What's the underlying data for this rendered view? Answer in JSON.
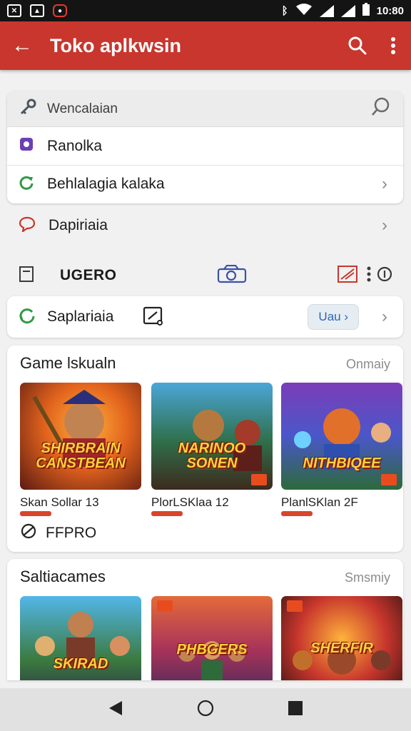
{
  "status_bar": {
    "time": "10:80"
  },
  "app_bar": {
    "title": "Toko aplkwsin"
  },
  "menu": {
    "search_placeholder": "Wencalaian",
    "items": [
      {
        "label": "Ranolka"
      },
      {
        "label": "Behlalagia kalaka"
      }
    ]
  },
  "dapiriaia": {
    "label": "Dapiriaia"
  },
  "toolbar": {
    "label": "UGERO"
  },
  "saplariaia": {
    "label": "Saplariaia",
    "pill": "Uau ›"
  },
  "section1": {
    "title": "Game lskualn",
    "more": "Onmaiy",
    "games": [
      {
        "name": "Skan Sollar 13",
        "art": "SHIRBRAIN CANSTBEAN"
      },
      {
        "name": "PlorLSKlaa 12",
        "art": "NARINOO SONEN"
      },
      {
        "name": "PlanlSKlan 2F",
        "art": "NITHBIQEE"
      }
    ],
    "footer_label": "FFPRO"
  },
  "section2": {
    "title": "Saltiacames",
    "more": "Smsmiy",
    "games": [
      {
        "art": "SKIRAD"
      },
      {
        "art": "PHBGERS"
      },
      {
        "art": "SHERFIR"
      }
    ]
  },
  "colors": {
    "accent": "#c8362d",
    "link": "#2e63b8"
  },
  "icons": [
    "back-arrow-icon",
    "search-icon",
    "more-vert-icon",
    "key-icon",
    "puzzle-icon",
    "refresh-icon",
    "chat-bubble-icon",
    "document-icon",
    "camera-icon",
    "edit-icon",
    "circle-arrows-icon",
    "crop-icon",
    "link-icon",
    "nav-back-icon",
    "nav-home-icon",
    "nav-recents-icon"
  ]
}
